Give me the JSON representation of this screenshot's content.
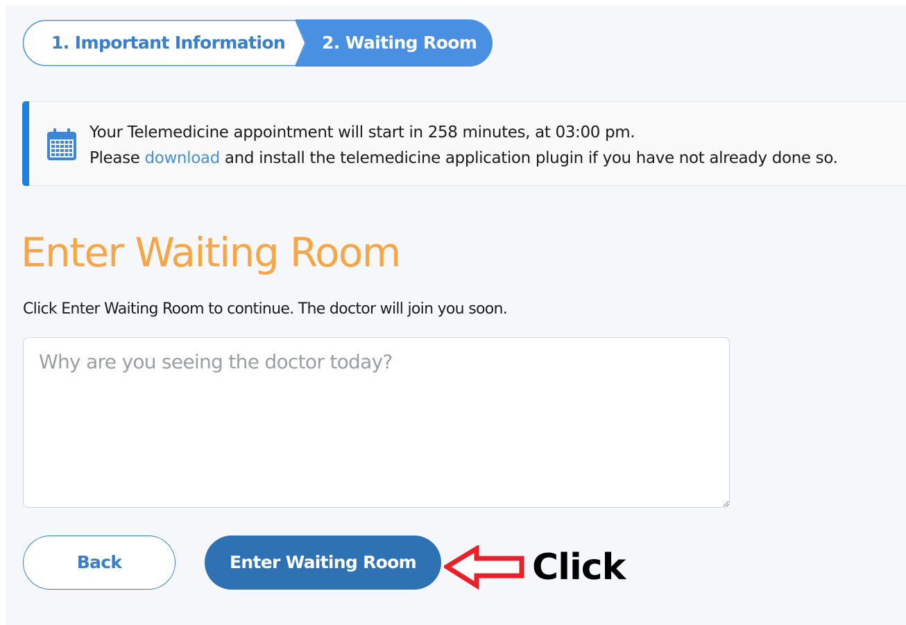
{
  "stepper": {
    "steps": [
      {
        "label": "1. Important Information"
      },
      {
        "label": "2. Waiting Room"
      }
    ]
  },
  "banner": {
    "line1": "Your Telemedicine appointment will start in 258 minutes, at 03:00 pm.",
    "line2_prefix": "Please ",
    "link_label": "download",
    "line2_suffix": " and install the telemedicine application plugin if you have not already done so."
  },
  "main": {
    "heading": "Enter Waiting Room",
    "instruction": "Click Enter Waiting Room to continue. The doctor will join you soon.",
    "reason_placeholder": "Why are you seeing the doctor today?",
    "reason_value": ""
  },
  "actions": {
    "back_label": "Back",
    "enter_label": "Enter Waiting Room"
  },
  "annotation": {
    "label": "Click"
  },
  "colors": {
    "accent_blue": "#4a90e2",
    "heading_orange": "#f6a646",
    "button_blue": "#2f72b4",
    "annotation_red": "#e8202a"
  },
  "icons": {
    "banner": "calendar-icon",
    "annotation": "arrow-left-icon"
  }
}
